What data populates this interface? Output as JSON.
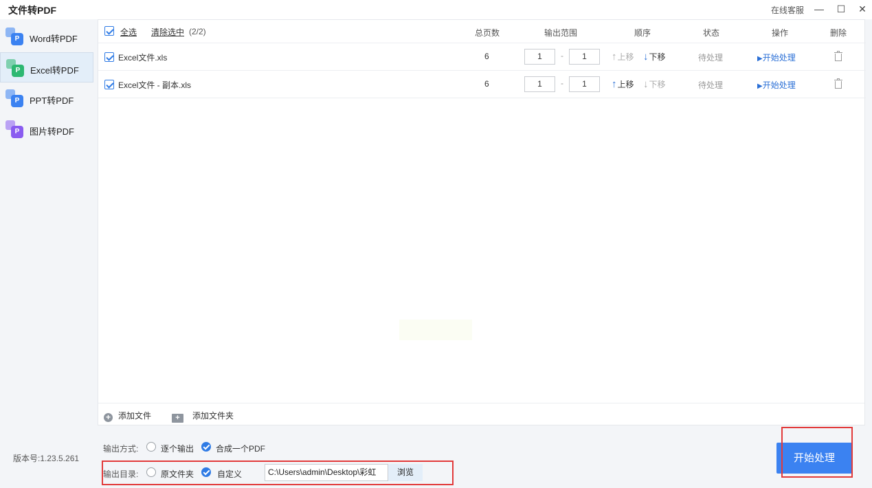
{
  "app": {
    "title": "文件转PDF",
    "online_service": "在线客服",
    "minimize": "—",
    "maximize": "☐",
    "close": "✕",
    "version": "版本号:1.23.5.261"
  },
  "sidebar": {
    "items": [
      {
        "label": "Word转PDF",
        "color": "#3b82f1"
      },
      {
        "label": "Excel转PDF",
        "color": "#2eb872"
      },
      {
        "label": "PPT转PDF",
        "color": "#3b82f1"
      },
      {
        "label": "图片转PDF",
        "color": "#8a5cf0"
      }
    ],
    "icon_letter": "P",
    "active_index": 1
  },
  "table": {
    "select_all": "全选",
    "clear_selected": "清除选中",
    "count": "(2/2)",
    "headers": {
      "pages": "总页数",
      "range": "输出范围",
      "order": "顺序",
      "status": "状态",
      "action": "操作",
      "delete": "删除"
    },
    "rows": [
      {
        "name": "Excel文件.xls",
        "pages": "6",
        "range_from": "1",
        "range_to": "1",
        "move_up": "上移",
        "move_down": "下移",
        "status": "待处理",
        "action": "开始处理"
      },
      {
        "name": "Excel文件 - 副本.xls",
        "pages": "6",
        "range_from": "1",
        "range_to": "1",
        "move_up": "上移",
        "move_down": "下移",
        "status": "待处理",
        "action": "开始处理"
      }
    ],
    "range_sep": "-"
  },
  "footer": {
    "add_file": "添加文件",
    "add_folder": "添加文件夹"
  },
  "options": {
    "output_mode_label": "输出方式:",
    "mode_each": "逐个输出",
    "mode_merge": "合成一个PDF",
    "output_dir_label": "输出目录:",
    "dir_original": "原文件夹",
    "dir_custom": "自定义",
    "path": "C:\\Users\\admin\\Desktop\\彩虹",
    "browse": "浏览"
  },
  "start_button": "开始处理",
  "colors": {
    "accent": "#3b82f1",
    "highlight": "#e23a3a"
  }
}
